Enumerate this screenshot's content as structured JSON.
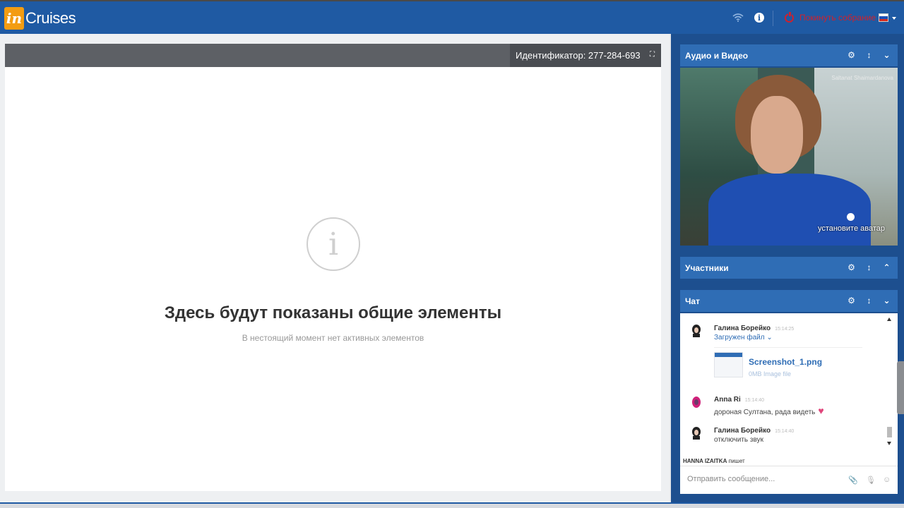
{
  "app": {
    "logo_mark": "in",
    "logo_text": "Cruises"
  },
  "topbar": {
    "leave_label": "Покинуть собрание",
    "info_icon": "info-icon",
    "wifi_icon": "wifi-icon",
    "language_flag": "ru-flag"
  },
  "stage": {
    "id_label": "Идентификатор: 277-284-693",
    "empty_title": "Здесь будут показаны общие элементы",
    "empty_subtitle": "В нестоящий момент нет активных элементов"
  },
  "panels": {
    "audio_video": "Аудио и Видео",
    "participants": "Участники",
    "chat": "Чат"
  },
  "video": {
    "participant_name": "Saltanat Shaimardanova",
    "set_avatar": "установите аватар"
  },
  "chat": {
    "messages": [
      {
        "name": "Галина Борейко",
        "time": "15:14:25",
        "text": "Загружен файл"
      },
      {
        "name": "Anna Ri",
        "time": "15:14:40",
        "text": "дороная Султана, рада видеть"
      },
      {
        "name": "Галина Борейко",
        "time": "15:14:40",
        "text": "отключить звук"
      }
    ],
    "file": {
      "name": "Screenshot_1.png",
      "meta": "0MB Image file"
    },
    "typing_name": "HANNA IZAITKA",
    "typing_suffix": "пишет",
    "input_placeholder": "Отправить сообщение..."
  },
  "colors": {
    "brand_blue": "#1f5aa3",
    "panel_blue": "#2f6db5",
    "leave_red": "#d0202c",
    "logo_orange": "#f39c12"
  }
}
